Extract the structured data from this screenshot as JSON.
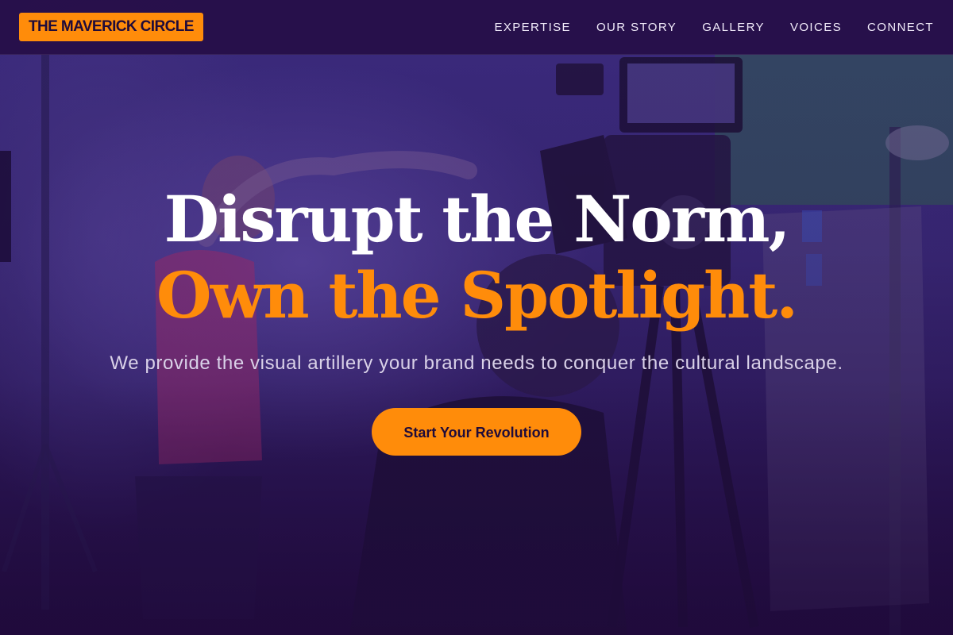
{
  "brand": {
    "logo_text": "THE MAVERICK CIRCLE",
    "accent": "#ff8c0a",
    "background": "#1f0b3a"
  },
  "nav": {
    "items": [
      {
        "label": "EXPERTISE"
      },
      {
        "label": "OUR STORY"
      },
      {
        "label": "GALLERY"
      },
      {
        "label": "VOICES"
      },
      {
        "label": "CONNECT"
      }
    ]
  },
  "hero": {
    "headline_line1": "Disrupt the Norm,",
    "headline_line2": "Own the Spotlight.",
    "subtitle": "We provide the visual artillery your brand needs to conquer the cultural landscape.",
    "cta_label": "Start Your Revolution",
    "background_image": "film-set-photo"
  }
}
